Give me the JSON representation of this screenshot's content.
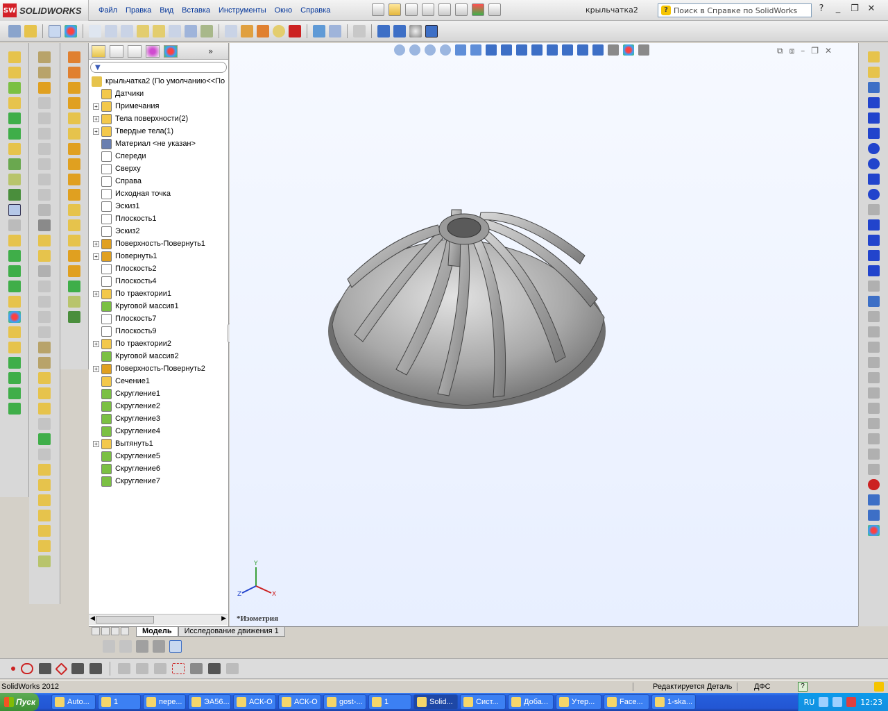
{
  "app": {
    "logo_text": "SOLIDWORKS",
    "logo_badge": "SW",
    "doc_title": "крыльчатка2"
  },
  "menu": [
    "Файл",
    "Правка",
    "Вид",
    "Вставка",
    "Инструменты",
    "Окно",
    "Справка"
  ],
  "help_search": {
    "placeholder": "Поиск в Справке по SolidWorks"
  },
  "tree": {
    "root": "крыльчатка2  (По умолчанию<<По",
    "items": [
      {
        "label": "Датчики",
        "icon": "sensor-icon",
        "expand": false,
        "color": "#f3c84b"
      },
      {
        "label": "Примечания",
        "icon": "annotation-icon",
        "expand": true,
        "color": "#f3c84b"
      },
      {
        "label": "Тела поверхности(2)",
        "icon": "surface-bodies-icon",
        "expand": true,
        "color": "#f3c84b"
      },
      {
        "label": "Твердые тела(1)",
        "icon": "solid-bodies-icon",
        "expand": true,
        "color": "#f3c84b"
      },
      {
        "label": "Материал <не указан>",
        "icon": "material-icon",
        "expand": false,
        "color": "#6a7fb0"
      },
      {
        "label": "Спереди",
        "icon": "plane-icon",
        "expand": false,
        "color": "#ffffff"
      },
      {
        "label": "Сверху",
        "icon": "plane-icon",
        "expand": false,
        "color": "#ffffff"
      },
      {
        "label": "Справа",
        "icon": "plane-icon",
        "expand": false,
        "color": "#ffffff"
      },
      {
        "label": "Исходная точка",
        "icon": "origin-icon",
        "expand": false,
        "color": "#ffffff"
      },
      {
        "label": "Эскиз1",
        "icon": "sketch-icon",
        "expand": false,
        "color": "#ffffff"
      },
      {
        "label": "Плоскость1",
        "icon": "plane-icon",
        "expand": false,
        "color": "#ffffff"
      },
      {
        "label": "Эскиз2",
        "icon": "sketch-icon",
        "expand": false,
        "color": "#ffffff"
      },
      {
        "label": "Поверхность-Повернуть1",
        "icon": "surface-revolve-icon",
        "expand": true,
        "color": "#e0a020"
      },
      {
        "label": "Повернуть1",
        "icon": "revolve-icon",
        "expand": true,
        "color": "#e0a020"
      },
      {
        "label": "Плоскость2",
        "icon": "plane-icon",
        "expand": false,
        "color": "#ffffff"
      },
      {
        "label": "Плоскость4",
        "icon": "plane-icon",
        "expand": false,
        "color": "#ffffff"
      },
      {
        "label": "По траектории1",
        "icon": "sweep-icon",
        "expand": true,
        "color": "#f3c84b"
      },
      {
        "label": "Круговой массив1",
        "icon": "circular-pattern-icon",
        "expand": false,
        "color": "#7bc043"
      },
      {
        "label": "Плоскость7",
        "icon": "plane-icon",
        "expand": false,
        "color": "#ffffff"
      },
      {
        "label": "Плоскость9",
        "icon": "plane-icon",
        "expand": false,
        "color": "#ffffff"
      },
      {
        "label": "По траектории2",
        "icon": "sweep-icon",
        "expand": true,
        "color": "#f3c84b"
      },
      {
        "label": "Круговой массив2",
        "icon": "circular-pattern-icon",
        "expand": false,
        "color": "#7bc043"
      },
      {
        "label": "Поверхность-Повернуть2",
        "icon": "surface-revolve-icon",
        "expand": true,
        "color": "#e0a020"
      },
      {
        "label": "Сечение1",
        "icon": "section-icon",
        "expand": false,
        "color": "#f3c84b"
      },
      {
        "label": "Скругление1",
        "icon": "fillet-icon",
        "expand": false,
        "color": "#7bc043"
      },
      {
        "label": "Скругление2",
        "icon": "fillet-icon",
        "expand": false,
        "color": "#7bc043"
      },
      {
        "label": "Скругление3",
        "icon": "fillet-icon",
        "expand": false,
        "color": "#7bc043"
      },
      {
        "label": "Скругление4",
        "icon": "fillet-icon",
        "expand": false,
        "color": "#7bc043"
      },
      {
        "label": "Вытянуть1",
        "icon": "extrude-icon",
        "expand": true,
        "color": "#f3c84b"
      },
      {
        "label": "Скругление5",
        "icon": "fillet-icon",
        "expand": false,
        "color": "#7bc043"
      },
      {
        "label": "Скругление6",
        "icon": "fillet-icon",
        "expand": false,
        "color": "#7bc043"
      },
      {
        "label": "Скругление7",
        "icon": "fillet-icon",
        "expand": false,
        "color": "#7bc043"
      }
    ]
  },
  "viewport": {
    "orientation": "*Изометрия",
    "axis_x": "X",
    "axis_y": "Y",
    "axis_z": "Z"
  },
  "bottom_tabs": [
    "Модель",
    "Исследование движения 1"
  ],
  "status": {
    "app": "SolidWorks 2012",
    "editing": "Редактируется Деталь",
    "units": "ДФС"
  },
  "taskbar": {
    "start": "Пуск",
    "tasks": [
      "Auto...",
      "1",
      "пере...",
      "ЭА56...",
      "АСК-О",
      "АСК-О",
      "gost-...",
      "1",
      "Solid...",
      "Сист...",
      "Доба...",
      "Утер...",
      "Face...",
      "1-ska..."
    ],
    "lang": "RU",
    "clock": "12:23"
  }
}
